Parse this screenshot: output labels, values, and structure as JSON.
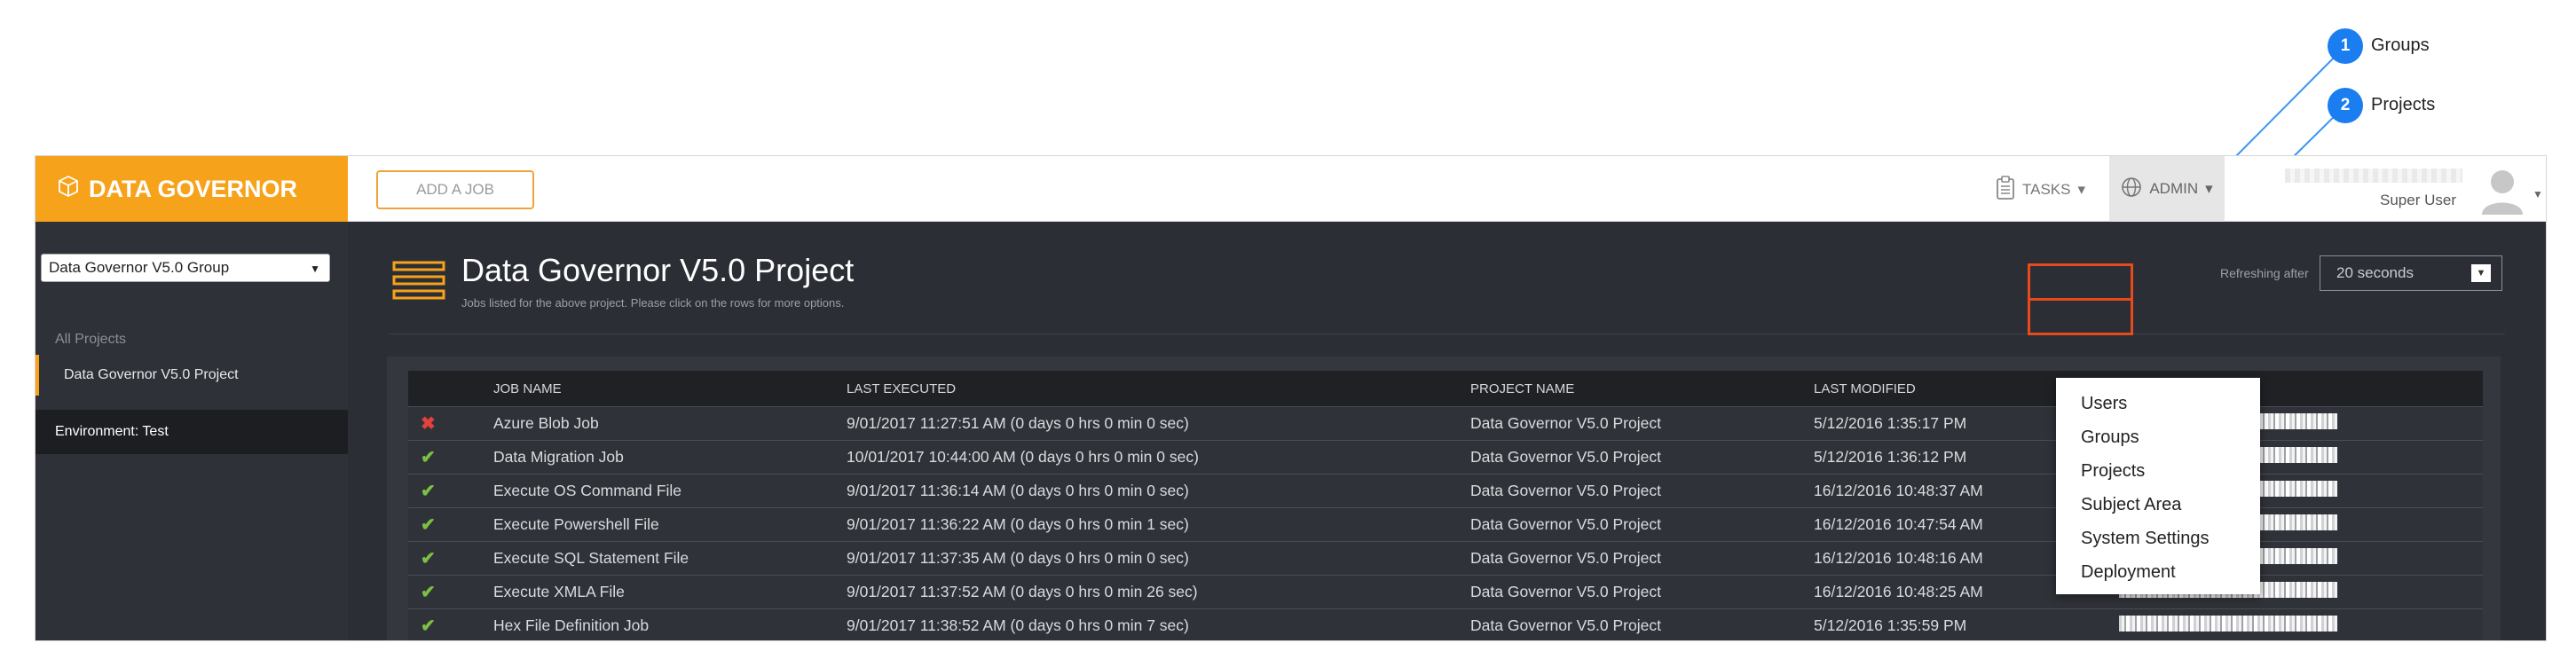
{
  "callouts": [
    {
      "number": "1",
      "label": "Groups"
    },
    {
      "number": "2",
      "label": "Projects"
    }
  ],
  "brand": {
    "title": "DATA GOVERNOR",
    "color": "#f7a21b"
  },
  "topbar": {
    "add_job_label": "ADD A JOB",
    "tasks_label": "TASKS",
    "admin_label": "ADMIN",
    "user_role": "Super User"
  },
  "sidebar": {
    "group_select_value": "Data Governor V5.0 Group",
    "all_projects_label": "All Projects",
    "project_item": "Data Governor V5.0 Project",
    "environment_label": "Environment: Test"
  },
  "main": {
    "title": "Data Governor V5.0 Project",
    "subtitle": "Jobs listed for the above project. Please click on the rows for more options.",
    "refresh_label": "Refreshing after",
    "refresh_value": "20 seconds"
  },
  "table": {
    "headers": [
      "JOB NAME",
      "LAST EXECUTED",
      "PROJECT NAME",
      "LAST MODIFIED"
    ],
    "rows": [
      {
        "status": "fail",
        "name": "Azure Blob Job",
        "executed": "9/01/2017 11:27:51 AM (0 days 0 hrs 0 min 0 sec)",
        "project": "Data Governor V5.0 Project",
        "modified": "5/12/2016 1:35:17 PM"
      },
      {
        "status": "ok",
        "name": "Data Migration Job",
        "executed": "10/01/2017 10:44:00 AM (0 days 0 hrs 0 min 0 sec)",
        "project": "Data Governor V5.0 Project",
        "modified": "5/12/2016 1:36:12 PM"
      },
      {
        "status": "ok",
        "name": "Execute OS Command File",
        "executed": "9/01/2017 11:36:14 AM (0 days 0 hrs 0 min 0 sec)",
        "project": "Data Governor V5.0 Project",
        "modified": "16/12/2016 10:48:37 AM"
      },
      {
        "status": "ok",
        "name": "Execute Powershell File",
        "executed": "9/01/2017 11:36:22 AM (0 days 0 hrs 0 min 1 sec)",
        "project": "Data Governor V5.0 Project",
        "modified": "16/12/2016 10:47:54 AM"
      },
      {
        "status": "ok",
        "name": "Execute SQL Statement File",
        "executed": "9/01/2017 11:37:35 AM (0 days 0 hrs 0 min 0 sec)",
        "project": "Data Governor V5.0 Project",
        "modified": "16/12/2016 10:48:16 AM"
      },
      {
        "status": "ok",
        "name": "Execute XMLA File",
        "executed": "9/01/2017 11:37:52 AM (0 days 0 hrs 0 min 26 sec)",
        "project": "Data Governor V5.0 Project",
        "modified": "16/12/2016 10:48:25 AM"
      },
      {
        "status": "ok",
        "name": "Hex File Definition Job",
        "executed": "9/01/2017 11:38:52 AM (0 days 0 hrs 0 min 7 sec)",
        "project": "Data Governor V5.0 Project",
        "modified": "5/12/2016 1:35:59 PM"
      }
    ]
  },
  "admin_menu": {
    "items": [
      "Users",
      "Groups",
      "Projects",
      "Subject Area",
      "System Settings",
      "Deployment"
    ]
  },
  "icons": {
    "brand": "cube-icon",
    "tasks": "clipboard-icon",
    "admin": "globe-icon",
    "avatar": "user-avatar-icon",
    "status_ok": "check-icon",
    "status_fail": "cross-icon"
  },
  "colors": {
    "accent": "#f7a21b",
    "callout": "#1a7df0",
    "highlight": "#e74a1c",
    "status_ok": "#7bc043",
    "status_fail": "#e2413d"
  }
}
